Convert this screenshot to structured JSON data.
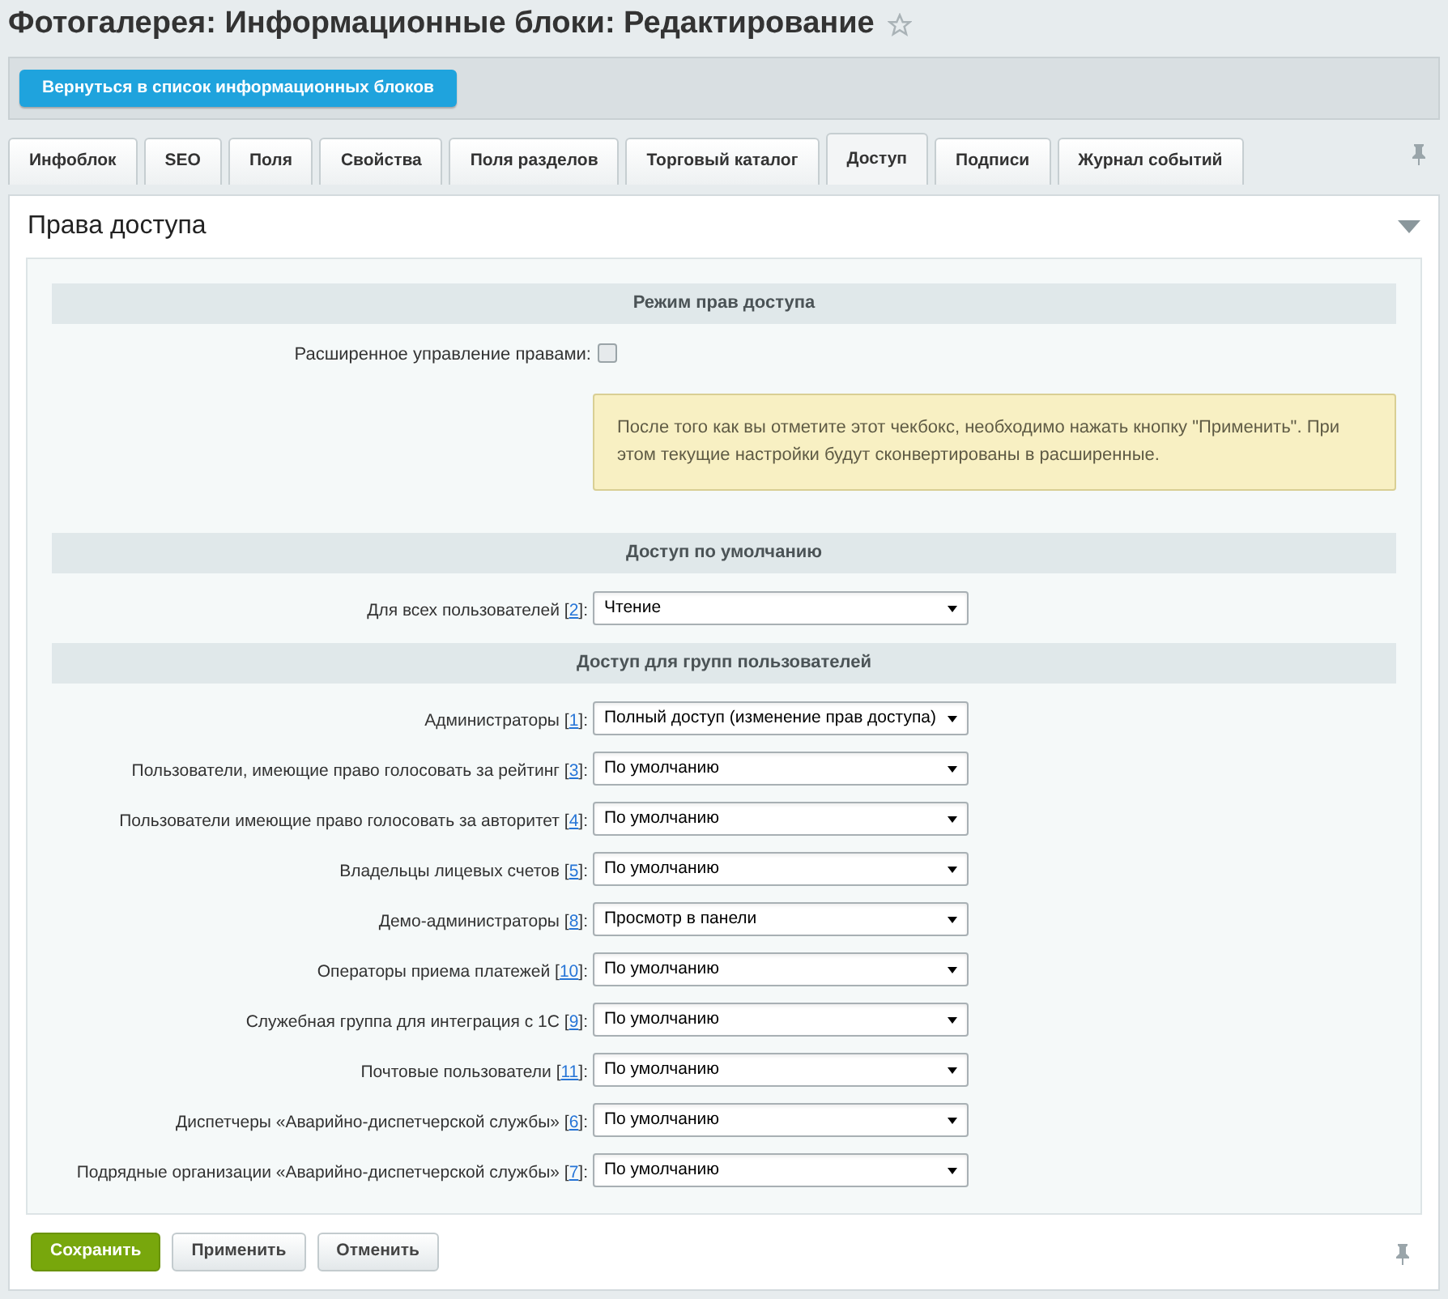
{
  "page": {
    "title": "Фотогалерея: Информационные блоки: Редактирование",
    "favorite": false
  },
  "toolbar": {
    "back_button": "Вернуться в список информационных блоков"
  },
  "tabs": [
    {
      "label": "Инфоблок",
      "selected": false
    },
    {
      "label": "SEO",
      "selected": false
    },
    {
      "label": "Поля",
      "selected": false
    },
    {
      "label": "Свойства",
      "selected": false
    },
    {
      "label": "Поля разделов",
      "selected": false
    },
    {
      "label": "Торговый каталог",
      "selected": false
    },
    {
      "label": "Доступ",
      "selected": true
    },
    {
      "label": "Подписи",
      "selected": false
    },
    {
      "label": "Журнал событий",
      "selected": false
    }
  ],
  "panel": {
    "title": "Права доступа",
    "expanded": true
  },
  "sections": [
    {
      "heading": "Режим прав доступа",
      "rows": [
        {
          "kind": "checkbox",
          "label": "Расширенное управление правами:",
          "checked": false
        },
        {
          "kind": "note",
          "text": "После того как вы отметите этот чекбокс, необходимо нажать кнопку \"Применить\". При этом текущие настройки будут сконвертированы в расширенные."
        }
      ]
    },
    {
      "heading": "Доступ по умолчанию",
      "rows": [
        {
          "kind": "select",
          "label": "Для всех пользователей [",
          "ref": "2",
          "after": "]:",
          "value": "Чтение"
        }
      ]
    },
    {
      "heading": "Доступ для групп пользователей",
      "rows": [
        {
          "kind": "select",
          "label": "Администраторы [",
          "ref": "1",
          "after": "]:",
          "value": "Полный доступ (изменение прав доступа)"
        },
        {
          "kind": "select",
          "label": "Пользователи, имеющие право голосовать за рейтинг [",
          "ref": "3",
          "after": "]:",
          "value": "По умолчанию"
        },
        {
          "kind": "select",
          "label": "Пользователи имеющие право голосовать за авторитет [",
          "ref": "4",
          "after": "]:",
          "value": "По умолчанию"
        },
        {
          "kind": "select",
          "label": "Владельцы лицевых счетов [",
          "ref": "5",
          "after": "]:",
          "value": "По умолчанию"
        },
        {
          "kind": "select",
          "label": "Демо-администраторы [",
          "ref": "8",
          "after": "]:",
          "value": "Просмотр в панели"
        },
        {
          "kind": "select",
          "label": "Операторы приема платежей [",
          "ref": "10",
          "after": "]:",
          "value": "По умолчанию"
        },
        {
          "kind": "select",
          "label": "Служебная группа для интеграция с 1С [",
          "ref": "9",
          "after": "]:",
          "value": "По умолчанию"
        },
        {
          "kind": "select",
          "label": "Почтовые пользователи [",
          "ref": "11",
          "after": "]:",
          "value": "По умолчанию"
        },
        {
          "kind": "select",
          "label": "Диспетчеры «Аварийно-диспетчерской службы» [",
          "ref": "6",
          "after": "]:",
          "value": "По умолчанию"
        },
        {
          "kind": "select",
          "label": "Подрядные организации «Аварийно-диспетчерской службы» [",
          "ref": "7",
          "after": "]:",
          "value": "По умолчанию"
        }
      ]
    }
  ],
  "buttons": [
    {
      "label": "Сохранить",
      "kind": "primary"
    },
    {
      "label": "Применить",
      "kind": "default"
    },
    {
      "label": "Отменить",
      "kind": "default"
    }
  ]
}
